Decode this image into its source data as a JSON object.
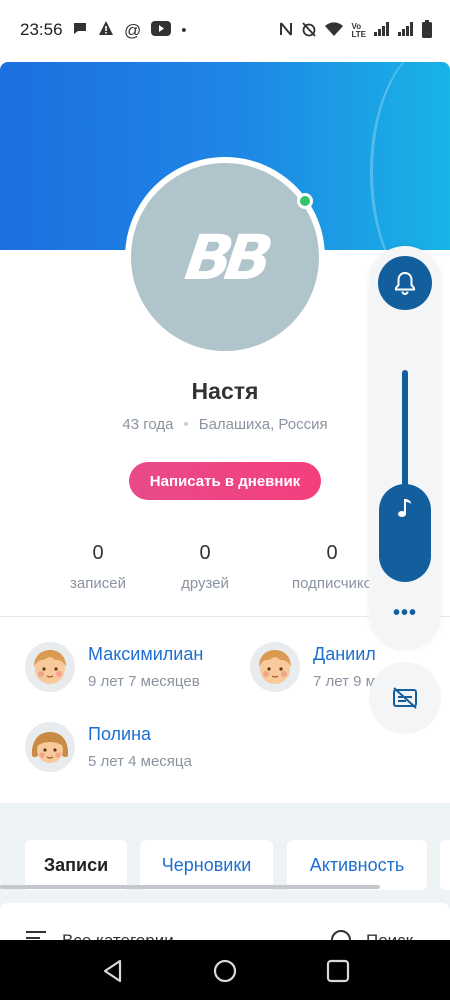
{
  "status_bar": {
    "time": "23:56",
    "dot": "•"
  },
  "profile": {
    "name": "Настя",
    "age": "43 года",
    "location": "Балашиха, Россия",
    "write_button": "Написать в дневник",
    "avatar_logo": "BB"
  },
  "stats": [
    {
      "value": "0",
      "label": "записей"
    },
    {
      "value": "0",
      "label": "друзей"
    },
    {
      "value": "0",
      "label": "подписчико"
    }
  ],
  "children": [
    {
      "name": "Максимилиан",
      "age": "9 лет 7 месяцев"
    },
    {
      "name": "Даниил",
      "age": "7 лет 9 м"
    },
    {
      "name": "Полина",
      "age": "5 лет 4 месяца"
    }
  ],
  "tabs": [
    {
      "label": "Записи"
    },
    {
      "label": "Черновики"
    },
    {
      "label": "Активность"
    }
  ],
  "filter_bar": {
    "categories": "Все категории",
    "search": "Поиск"
  },
  "volume_panel": {
    "more": "•••"
  },
  "colors": {
    "accent": "#1c6fd1",
    "cover": "#1e88e5",
    "write_button": "#f43f7e",
    "online": "#31c46b",
    "volume": "#135f9e"
  }
}
